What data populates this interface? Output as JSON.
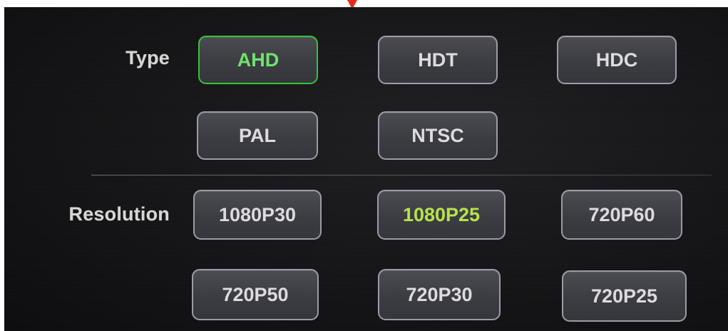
{
  "type_row": {
    "label": "Type",
    "options": [
      "AHD",
      "HDT",
      "HDC",
      "PAL",
      "NTSC"
    ],
    "selected": "AHD"
  },
  "resolution_row": {
    "label": "Resolution",
    "options": [
      "1080P30",
      "1080P25",
      "720P60",
      "720P50",
      "720P30",
      "720P25"
    ],
    "selected": "1080P25"
  },
  "colors": {
    "selected_border": "#35c23a",
    "selected_type_text": "#6ee36a",
    "selected_resolution_text": "#b6e24a",
    "marker": "#e32b20"
  },
  "icons": {
    "marker": "red-arrow-marker-icon"
  }
}
